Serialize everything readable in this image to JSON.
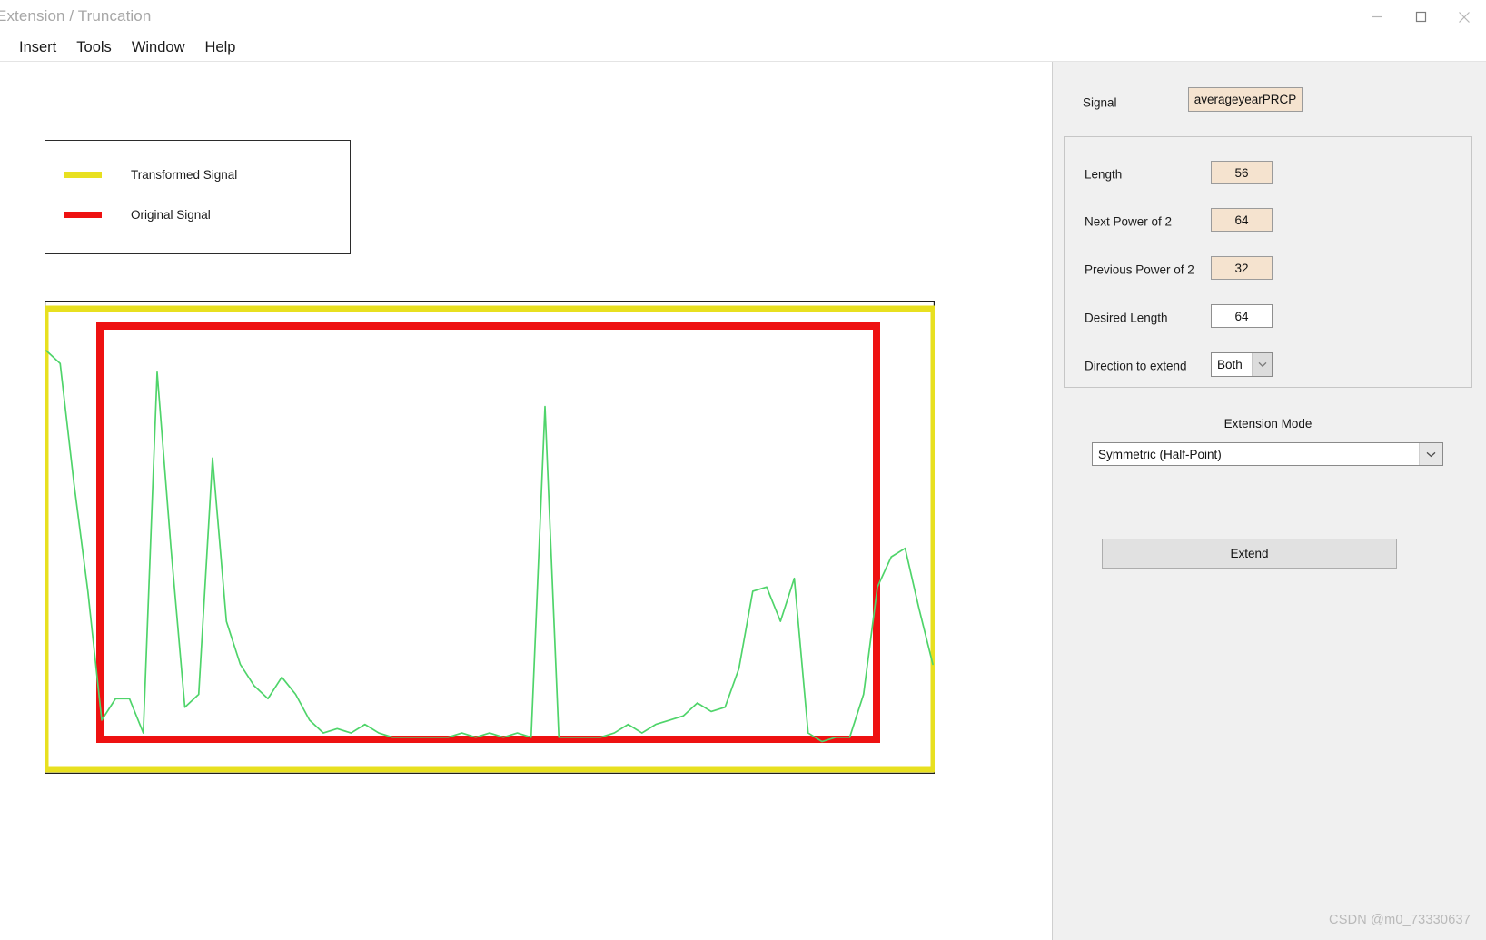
{
  "window": {
    "title": "Extension / Truncation",
    "controls": [
      {
        "name": "minimize-button",
        "icon": "minimize-icon"
      },
      {
        "name": "maximize-button",
        "icon": "maximize-icon"
      },
      {
        "name": "close-button",
        "icon": "close-icon"
      }
    ]
  },
  "menubar": {
    "items": [
      "Insert",
      "Tools",
      "Window",
      "Help"
    ]
  },
  "legend": {
    "items": [
      {
        "label": "Transformed Signal",
        "color": "#e8e020"
      },
      {
        "label": "Original Signal",
        "color": "#ee1111"
      }
    ]
  },
  "panel": {
    "signal": {
      "label": "Signal",
      "value": "averageyearPRCP"
    },
    "fields": [
      {
        "label": "Length",
        "value": "56",
        "editable": false
      },
      {
        "label": "Next Power of 2",
        "value": "64",
        "editable": false
      },
      {
        "label": "Previous Power of 2",
        "value": "32",
        "editable": false
      },
      {
        "label": "Desired Length",
        "value": "64",
        "editable": true
      }
    ],
    "direction": {
      "label": "Direction to extend",
      "value": "Both"
    },
    "extension_mode": {
      "title": "Extension Mode",
      "value": "Symmetric (Half-Point)"
    },
    "extend_button": {
      "label": "Extend"
    }
  },
  "watermark": "CSDN @m0_73330637",
  "chart_data": {
    "type": "line",
    "title": "",
    "xlabel": "",
    "ylabel": "",
    "grid": false,
    "legend_position": "outside-top-left",
    "xlim": [
      0,
      64
    ],
    "ylim": [
      0,
      1
    ],
    "series": [
      {
        "name": "Transformed Signal",
        "color": "#e8e020",
        "role": "extended-extent-box",
        "x_range": [
          0,
          64
        ]
      },
      {
        "name": "Original Signal",
        "color": "#ee1111",
        "role": "original-extent-box",
        "x_range": [
          4,
          60
        ]
      },
      {
        "name": "Signal Trace",
        "color": "#4fd46a",
        "x": [
          0,
          1,
          2,
          3,
          4,
          5,
          6,
          7,
          8,
          9,
          10,
          11,
          12,
          13,
          14,
          15,
          16,
          17,
          18,
          19,
          20,
          21,
          22,
          23,
          24,
          25,
          26,
          27,
          28,
          29,
          30,
          31,
          32,
          33,
          34,
          35,
          36,
          37,
          38,
          39,
          40,
          41,
          42,
          43,
          44,
          45,
          46,
          47,
          48,
          49,
          50,
          51,
          52,
          53,
          54,
          55,
          56,
          57,
          58,
          59,
          60,
          61,
          62,
          63,
          64
        ],
        "values": [
          0.93,
          0.9,
          0.62,
          0.37,
          0.07,
          0.12,
          0.12,
          0.04,
          0.88,
          0.47,
          0.1,
          0.13,
          0.68,
          0.3,
          0.2,
          0.15,
          0.12,
          0.17,
          0.13,
          0.07,
          0.04,
          0.05,
          0.04,
          0.06,
          0.04,
          0.03,
          0.03,
          0.03,
          0.03,
          0.03,
          0.04,
          0.03,
          0.04,
          0.03,
          0.04,
          0.03,
          0.8,
          0.03,
          0.03,
          0.03,
          0.03,
          0.04,
          0.06,
          0.04,
          0.06,
          0.07,
          0.08,
          0.11,
          0.09,
          0.1,
          0.19,
          0.37,
          0.38,
          0.3,
          0.4,
          0.04,
          0.02,
          0.03,
          0.03,
          0.13,
          0.38,
          0.45,
          0.47,
          0.33,
          0.2
        ]
      }
    ]
  }
}
